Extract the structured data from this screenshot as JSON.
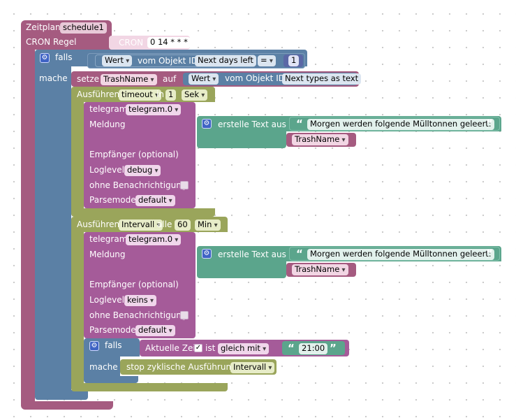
{
  "colors": {
    "schedule": "#a55b80",
    "blue": "#5b80a5",
    "green": "#9aa55b",
    "pink": "#a55b99",
    "teal": "#5ba58c",
    "text": "#5ba58c",
    "number": "#5b67a5"
  },
  "zeitplan": {
    "label": "Zeitplan",
    "value": "schedule1"
  },
  "cron": {
    "label": "CRON Regel",
    "chip": "CRON",
    "value": "0 14 * * *"
  },
  "falls1": {
    "label": "falls",
    "mache": "mache",
    "wert": "Wert",
    "vom": "vom Objekt ID",
    "object": "Next days left",
    "op": "=",
    "number": "1"
  },
  "setze": {
    "label": "setze",
    "var": "TrashName",
    "auf": "auf",
    "wert": "Wert",
    "vom": "vom Objekt ID",
    "object": "Next types as text"
  },
  "timeout": {
    "label": "Ausführen",
    "mode": "timeout",
    "in": "in",
    "value": "1",
    "unit": "Sek"
  },
  "telegram1": {
    "label": "telegram",
    "instance": "telegram.0",
    "meldung": "Meldung",
    "empfaenger": "Empfänger (optional)",
    "loglevel_label": "Loglevel",
    "loglevel": "debug",
    "ohne": "ohne Benachrichtigung",
    "parsemode_label": "Parsemode",
    "parsemode": "default"
  },
  "text1": {
    "label": "erstelle Text aus",
    "string": "Morgen werden folgende Mülltonnen geleert:",
    "var": "TrashName"
  },
  "interval": {
    "label": "Ausführen",
    "mode": "Intervall",
    "alle": "alle",
    "value": "60",
    "unit": "Min"
  },
  "telegram2": {
    "label": "telegram",
    "instance": "telegram.0",
    "meldung": "Meldung",
    "empfaenger": "Empfänger (optional)",
    "loglevel_label": "Loglevel",
    "loglevel": "keins",
    "ohne": "ohne Benachrichtigung",
    "parsemode_label": "Parsemode",
    "parsemode": "default"
  },
  "text2": {
    "label": "erstelle Text aus",
    "string": "Morgen werden folgende Mülltonnen geleert:",
    "var": "TrashName"
  },
  "falls2": {
    "label": "falls",
    "mache": "mache",
    "zeit": "Aktuelle Zeit",
    "ist": "ist",
    "op": "gleich mit",
    "time": "21:00"
  },
  "stop": {
    "label": "stop zyklische Ausführung",
    "target": "Intervall"
  }
}
